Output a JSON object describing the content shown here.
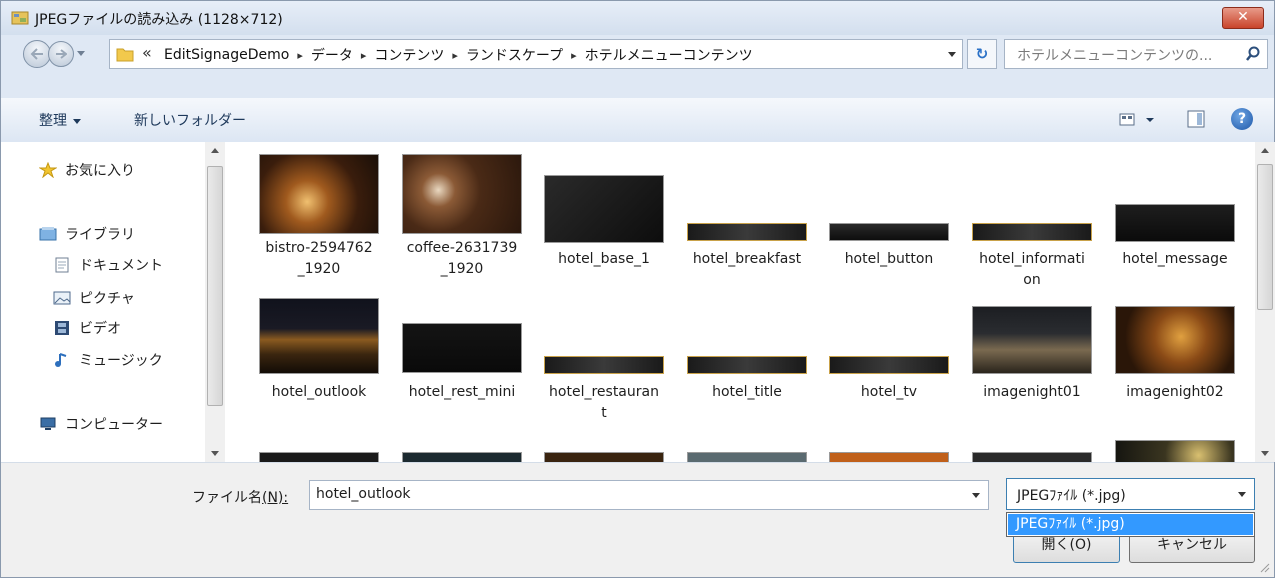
{
  "window": {
    "title": "JPEGファイルの読み込み (1128×712)",
    "close_glyph": "✕"
  },
  "address": {
    "overflow_glyph": "«",
    "crumbs": [
      "EditSignageDemo",
      "データ",
      "コンテンツ",
      "ランドスケープ",
      "ホテルメニューコンテンツ"
    ],
    "separator": "▸",
    "refresh_glyph": "↻"
  },
  "search": {
    "placeholder": "ホテルメニューコンテンツの..."
  },
  "toolbar": {
    "organize_label": "整理",
    "new_folder_label": "新しいフォルダー",
    "help_glyph": "?"
  },
  "nav": {
    "favorites": "お気に入り",
    "libraries": "ライブラリ",
    "documents": "ドキュメント",
    "pictures": "ピクチャ",
    "videos": "ビデオ",
    "music": "ミュージック",
    "computer": "コンピューター"
  },
  "files": [
    {
      "name": "bistro-2594762_1920",
      "name_lines": [
        "bistro-2594762",
        "_1920"
      ],
      "thumb": "photo-bistro"
    },
    {
      "name": "coffee-2631739_1920",
      "name_lines": [
        "coffee-2631739",
        "_1920"
      ],
      "thumb": "photo-coffee"
    },
    {
      "name": "hotel_base_1",
      "name_lines": [
        "hotel_base_1"
      ],
      "thumb": "dark-panel"
    },
    {
      "name": "hotel_breakfast",
      "name_lines": [
        "hotel_breakfast"
      ],
      "thumb": "dark-banner"
    },
    {
      "name": "hotel_button",
      "name_lines": [
        "hotel_button"
      ],
      "thumb": "dark-bar"
    },
    {
      "name": "hotel_information",
      "name_lines": [
        "hotel_informati",
        "on"
      ],
      "thumb": "dark-banner"
    },
    {
      "name": "hotel_message",
      "name_lines": [
        "hotel_message"
      ],
      "thumb": "dark-banner-tall"
    },
    {
      "name": "hotel_outlook",
      "name_lines": [
        "hotel_outlook"
      ],
      "thumb": "photo-night"
    },
    {
      "name": "hotel_rest_mini",
      "name_lines": [
        "hotel_rest_mini"
      ],
      "thumb": "dark-sign"
    },
    {
      "name": "hotel_restaurant",
      "name_lines": [
        "hotel_restauran",
        "t"
      ],
      "thumb": "dark-banner"
    },
    {
      "name": "hotel_title",
      "name_lines": [
        "hotel_title"
      ],
      "thumb": "dark-banner"
    },
    {
      "name": "hotel_tv",
      "name_lines": [
        "hotel_tv"
      ],
      "thumb": "dark-banner"
    },
    {
      "name": "imagenight01",
      "name_lines": [
        "imagenight01"
      ],
      "thumb": "photo-city"
    },
    {
      "name": "imagenight02",
      "name_lines": [
        "imagenight02"
      ],
      "thumb": "photo-amber"
    }
  ],
  "footer": {
    "filename_label": "ファイル名",
    "filename_hotkey": "(N):",
    "filename_value": "hotel_outlook",
    "filetype_value": "JPEGﾌｧｲﾙ (*.jpg)",
    "filetype_options": [
      "JPEGﾌｧｲﾙ (*.jpg)"
    ],
    "open_label": "開く(O)",
    "cancel_label": "キャンセル"
  },
  "colors": {
    "accent": "#3399ff",
    "chrome": "#dfe8f4",
    "close": "#c9442b"
  }
}
